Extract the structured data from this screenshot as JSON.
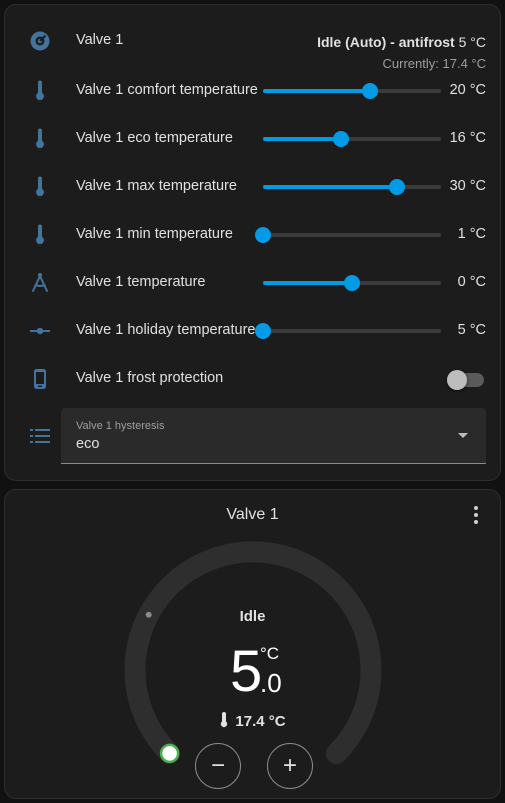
{
  "colors": {
    "accent": "#039be5",
    "icon": "#44739e",
    "handle": "#4caf50"
  },
  "climate_row": {
    "name": "Valve 1",
    "icon": "thermostat-icon",
    "state": "Idle (Auto) - antifrost",
    "target": "5 °C",
    "current": "Currently: 17.4 °C"
  },
  "number_rows": [
    {
      "name": "Valve 1 comfort temperature",
      "value": "20 °C",
      "level_percent": 60,
      "icon": "thermometer-icon"
    },
    {
      "name": "Valve 1 eco temperature",
      "value": "16 °C",
      "level_percent": 44,
      "icon": "thermometer-icon"
    },
    {
      "name": "Valve 1 max temperature",
      "value": "30 °C",
      "level_percent": 75,
      "icon": "thermometer-icon"
    },
    {
      "name": "Valve 1 min temperature",
      "value": "1 °C",
      "level_percent": 0,
      "icon": "thermometer-icon"
    },
    {
      "name": "Valve 1 temperature",
      "value": "0 °C",
      "level_percent": 50,
      "icon": "compass-icon"
    },
    {
      "name": "Valve 1 holiday temperature",
      "value": "5 °C",
      "level_percent": 0,
      "icon": "slider-icon"
    }
  ],
  "switch_row": {
    "name": "Valve 1 frost protection",
    "on": false,
    "icon": "phone-icon"
  },
  "select_row": {
    "label": "Valve 1 hysteresis",
    "value": "eco",
    "icon": "list-icon"
  },
  "thermostat": {
    "title": "Valve 1",
    "action": "Idle",
    "target_int": "5",
    "target_unit": "°C",
    "target_dec": ".0",
    "current": "17.4 °C",
    "minus": "−",
    "plus": "+",
    "target_fraction": 0.0,
    "current_fraction": 0.27
  }
}
